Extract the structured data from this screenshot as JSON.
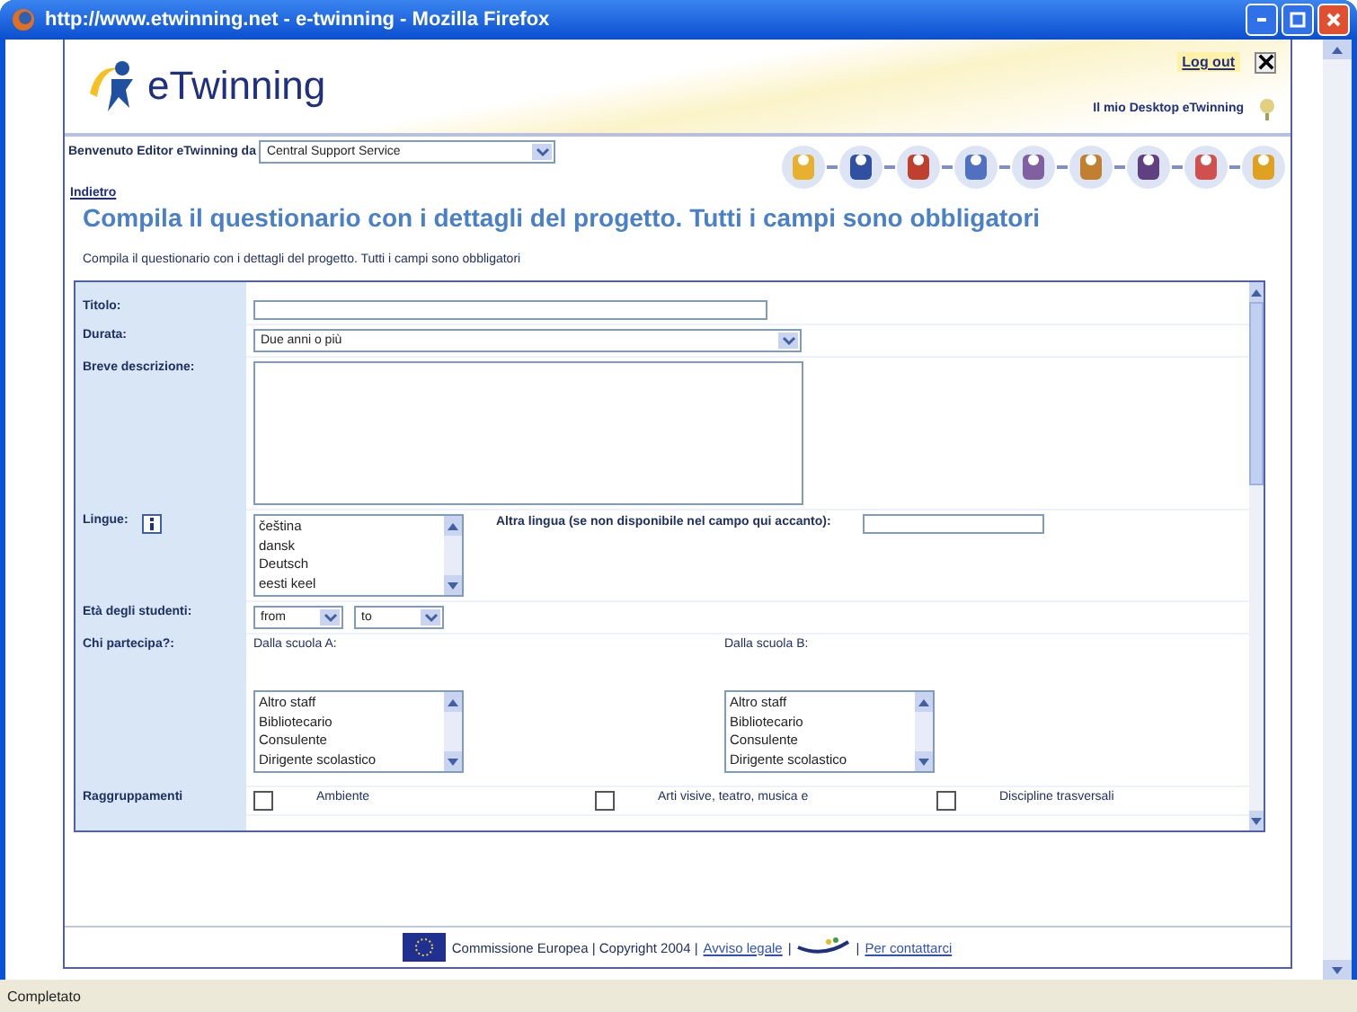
{
  "window": {
    "title": "http://www.etwinning.net - e-twinning - Mozilla Firefox"
  },
  "header": {
    "logo": "eTwinning",
    "logout": "Log out",
    "desktop_link": "Il mio Desktop eTwinning"
  },
  "greeting": {
    "label": "Benvenuto Editor eTwinning da",
    "select": "Central Support Service"
  },
  "back_link": "Indietro",
  "heading": "Compila il questionario con i dettagli del progetto. Tutti i campi sono obbligatori",
  "subheading": "Compila il questionario con i dettagli del progetto. Tutti i campi sono obbligatori",
  "form": {
    "title_label": "Titolo:",
    "duration_label": "Durata:",
    "duration_value": "Due anni o più",
    "description_label": "Breve descrizione:",
    "languages_label": "Lingue:",
    "languages": [
      "čeština",
      "dansk",
      "Deutsch",
      "eesti keel"
    ],
    "other_language_label": "Altra lingua (se non disponibile nel campo qui accanto):",
    "age_label": "Età degli studenti:",
    "age_from": "from",
    "age_to": "to",
    "participants_label": "Chi partecipa?:",
    "school_a_label": "Dalla scuola A:",
    "school_b_label": "Dalla scuola B:",
    "school_a": [
      "Altro staff",
      "Bibliotecario",
      "Consulente",
      "Dirigente scolastico"
    ],
    "school_b": [
      "Altro staff",
      "Bibliotecario",
      "Consulente",
      "Dirigente scolastico"
    ],
    "groups_label": "Raggruppamenti",
    "groups": [
      {
        "label": "Ambiente",
        "checked": false
      },
      {
        "label": "Arti visive, teatro, musica e",
        "checked": false
      },
      {
        "label": "Discipline trasversali",
        "checked": false
      }
    ]
  },
  "footer": {
    "text": "Commissione Europea | Copyright 2004 |",
    "legal_link": "Avviso legale",
    "separator": "|",
    "contact_link": "Per contattarci"
  },
  "status_bar": "Completato"
}
